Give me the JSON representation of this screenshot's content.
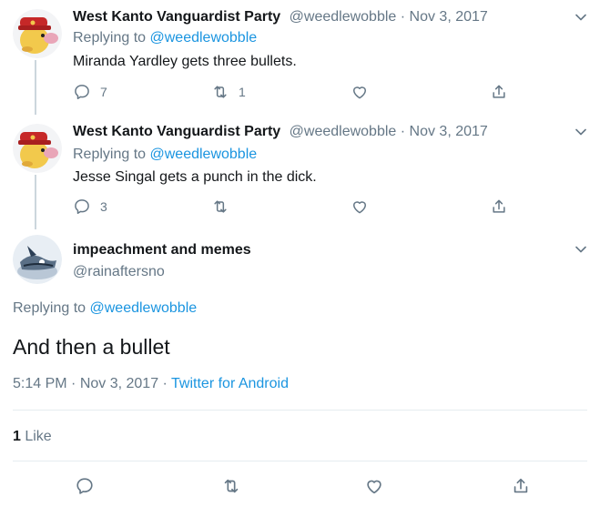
{
  "tweets": [
    {
      "name": "West Kanto Vanguardist Party",
      "handle": "@weedlewobble",
      "sep": " · ",
      "date": "Nov 3, 2017",
      "replying_prefix": "Replying to ",
      "replying_to": "@weedlewobble",
      "text": "Miranda Yardley gets three bullets.",
      "reply_count": "7",
      "retweet_count": "1",
      "like_count": ""
    },
    {
      "name": "West Kanto Vanguardist Party",
      "handle": "@weedlewobble",
      "sep": " · ",
      "date": "Nov 3, 2017",
      "replying_prefix": "Replying to ",
      "replying_to": "@weedlewobble",
      "text": "Jesse Singal gets a punch in the dick.",
      "reply_count": "3",
      "retweet_count": "",
      "like_count": ""
    }
  ],
  "main_tweet": {
    "name": "impeachment and memes",
    "handle": "@rainaftersno",
    "replying_prefix": "Replying to ",
    "replying_to": "@weedlewobble",
    "text": "And then a bullet",
    "time": "5:14 PM",
    "sep": " · ",
    "date": "Nov 3, 2017",
    "sep2": " · ",
    "source": "Twitter for Android",
    "like_count": "1",
    "like_label": " Like"
  },
  "icons": {
    "reply": "reply-icon",
    "retweet": "retweet-icon",
    "like": "heart-icon",
    "share": "share-icon",
    "caret": "chevron-down-icon"
  },
  "colors": {
    "link": "#1b95e0",
    "muted": "#657786",
    "text": "#14171a",
    "thread_line": "#ccd6dd"
  }
}
